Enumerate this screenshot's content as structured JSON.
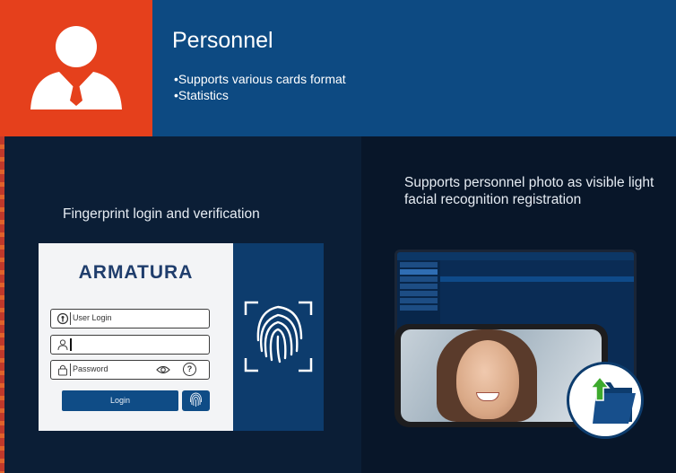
{
  "header": {
    "title": "Personnel",
    "bullets": [
      "Supports various cards format",
      "Statistics"
    ],
    "accent_color": "#e5401c",
    "bg_color": "#0d4a82"
  },
  "features": {
    "left_caption": "Fingerprint login and verification",
    "right_caption": "Supports personnel photo as visible light facial recognition registration"
  },
  "login": {
    "brand": "ARMATURA",
    "user_placeholder": "User Login",
    "password_placeholder": "Password",
    "help_glyph": "?",
    "login_label": "Login",
    "icons": [
      "user-login-icon",
      "person-icon",
      "lock-icon",
      "eye-icon",
      "help-icon",
      "fingerprint-icon"
    ]
  }
}
